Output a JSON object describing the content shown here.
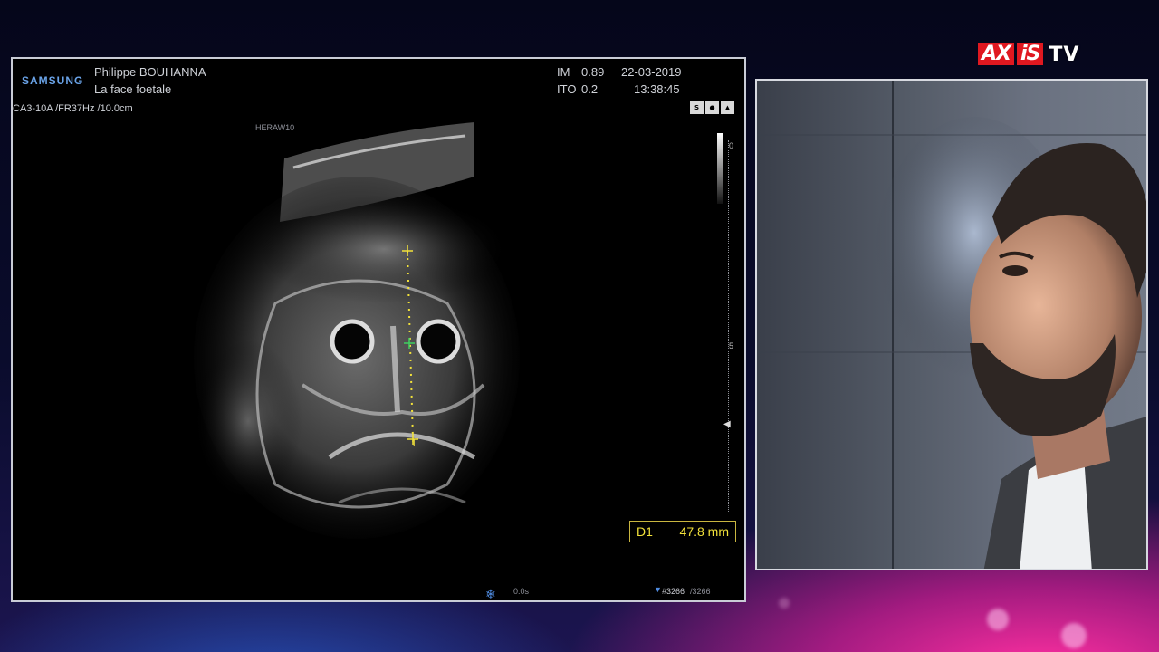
{
  "ultrasound": {
    "brand": "SAMSUNG",
    "operator": "Philippe BOUHANNA",
    "study": "La face foetale",
    "probe_info": "CA3-10A /FR37Hz /10.0cm",
    "preset_label": "HERAW10",
    "im_label": "IM",
    "im_value": "0.89",
    "ito_label": "ITO",
    "ito_value": "0.2",
    "date": "22-03-2019",
    "time": "13:38:45",
    "depth_top": "0",
    "depth_mid": "5",
    "caliper_label": "1",
    "measurement": {
      "label": "D1",
      "value": "47.8",
      "unit": "mm"
    },
    "cine_time": "0.0s",
    "frame_current": "#3266",
    "frame_total": "/3266",
    "mode_icons": [
      "S HAR",
      "face-icon",
      "tissue-icon"
    ]
  },
  "logo": {
    "part1": "AX",
    "part2": "iS",
    "part3": "TV"
  },
  "colors": {
    "caliper": "#f3e23a",
    "caliper_green": "#3fd060",
    "brand_blue": "#6aa3e8",
    "logo_red": "#e01820"
  }
}
